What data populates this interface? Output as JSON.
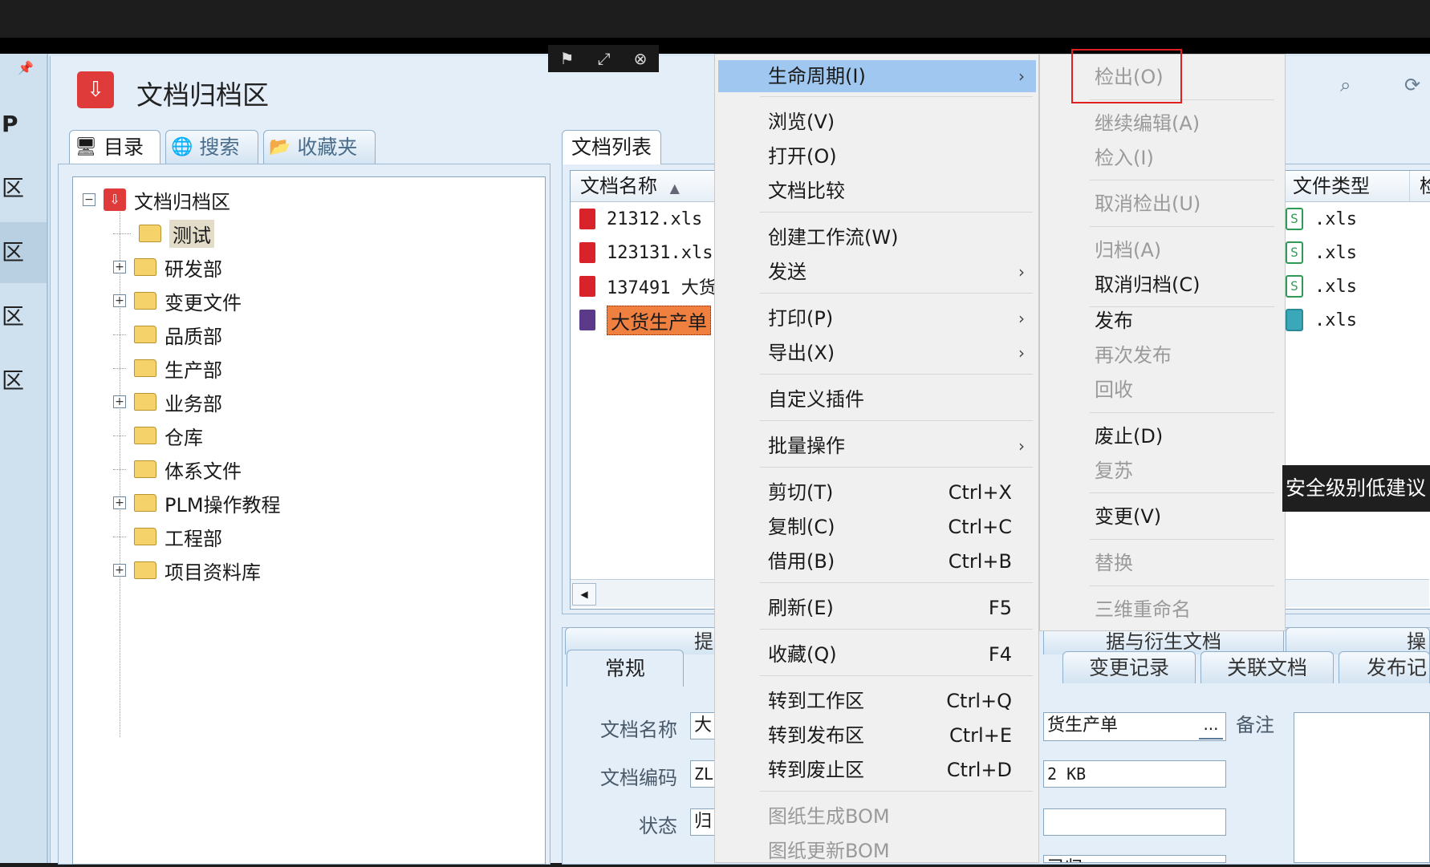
{
  "floatbar": {
    "icons": [
      "pin-icon",
      "resize-icon",
      "close-icon"
    ]
  },
  "leftstrip": {
    "items": [
      "P",
      "区",
      "区",
      "区",
      "区"
    ]
  },
  "window": {
    "title": "文档归档区"
  },
  "left_tabs": [
    {
      "label": "目录",
      "icon": "computer-icon"
    },
    {
      "label": "搜索",
      "icon": "search-globe-icon"
    },
    {
      "label": "收藏夹",
      "icon": "favorites-folder-icon"
    }
  ],
  "tree": {
    "root": "文档归档区",
    "items": [
      {
        "label": "测试",
        "expandable": false,
        "selected": true
      },
      {
        "label": "研发部",
        "expandable": true
      },
      {
        "label": "变更文件",
        "expandable": true
      },
      {
        "label": "品质部",
        "expandable": false
      },
      {
        "label": "生产部",
        "expandable": false
      },
      {
        "label": "业务部",
        "expandable": true
      },
      {
        "label": "仓库",
        "expandable": false
      },
      {
        "label": "体系文件",
        "expandable": false
      },
      {
        "label": "PLM操作教程",
        "expandable": true
      },
      {
        "label": "工程部",
        "expandable": false
      },
      {
        "label": "项目资料库",
        "expandable": true
      }
    ]
  },
  "list": {
    "tab": "文档列表",
    "columns": {
      "name": "文档名称",
      "type": "文件类型",
      "extra": "检"
    },
    "rows": [
      {
        "name": "21312.xls",
        "type": ".xls"
      },
      {
        "name": "123131.xls",
        "type": ".xls"
      },
      {
        "name": "137491 大货",
        "type": ".xls"
      },
      {
        "name": "大货生产单",
        "type": ".xls",
        "selected": true
      }
    ]
  },
  "bottom": {
    "upper_tabs": [
      "提",
      "据与衍生文档",
      "操"
    ],
    "tabs": [
      "常规",
      "变更记录",
      "关联文档",
      "发布记"
    ],
    "fields": [
      {
        "label": "文档名称",
        "value": "大"
      },
      {
        "label": "文档编码",
        "value": "ZL"
      },
      {
        "label": "状态",
        "value": "归"
      }
    ],
    "right_fields": [
      "货生产单",
      "2 KB",
      "",
      "已归"
    ],
    "remark_label": "备注",
    "browse_btn": "..."
  },
  "context_menu": {
    "items": [
      {
        "label": "生命周期(I)",
        "submenu": true,
        "highlight": true
      },
      {
        "label": "浏览(V)"
      },
      {
        "label": "打开(O)"
      },
      {
        "label": "文档比较"
      },
      {
        "label": "创建工作流(W)"
      },
      {
        "label": "发送",
        "submenu": true
      },
      {
        "label": "打印(P)",
        "submenu": true
      },
      {
        "label": "导出(X)",
        "submenu": true
      },
      {
        "label": "自定义插件"
      },
      {
        "label": "批量操作",
        "submenu": true
      },
      {
        "label": "剪切(T)",
        "shortcut": "Ctrl+X"
      },
      {
        "label": "复制(C)",
        "shortcut": "Ctrl+C"
      },
      {
        "label": "借用(B)",
        "shortcut": "Ctrl+B"
      },
      {
        "label": "刷新(E)",
        "shortcut": "F5"
      },
      {
        "label": "收藏(Q)",
        "shortcut": "F4"
      },
      {
        "label": "转到工作区",
        "shortcut": "Ctrl+Q"
      },
      {
        "label": "转到发布区",
        "shortcut": "Ctrl+E"
      },
      {
        "label": "转到废止区",
        "shortcut": "Ctrl+D"
      },
      {
        "label": "图纸生成BOM",
        "disabled": true
      },
      {
        "label": "图纸更新BOM",
        "disabled": true
      }
    ]
  },
  "submenu": {
    "items": [
      {
        "label": "检出(O)",
        "disabled": true
      },
      {
        "label": "继续编辑(A)",
        "disabled": true
      },
      {
        "label": "检入(I)",
        "disabled": true
      },
      {
        "label": "取消检出(U)",
        "disabled": true
      },
      {
        "label": "归档(A)",
        "disabled": true
      },
      {
        "label": "取消归档(C)"
      },
      {
        "label": "发布"
      },
      {
        "label": "再次发布",
        "disabled": true
      },
      {
        "label": "回收",
        "disabled": true
      },
      {
        "label": "废止(D)"
      },
      {
        "label": "复苏",
        "disabled": true
      },
      {
        "label": "变更(V)"
      },
      {
        "label": "替换",
        "disabled": true
      },
      {
        "label": "三维重命名",
        "disabled": true
      }
    ]
  },
  "tooltip": {
    "text": "安全级别低建议"
  },
  "colors": {
    "menu_highlight": "#9fc7ef",
    "annotation_red": "#e02020",
    "app_icon_red": "#e03b3b"
  }
}
